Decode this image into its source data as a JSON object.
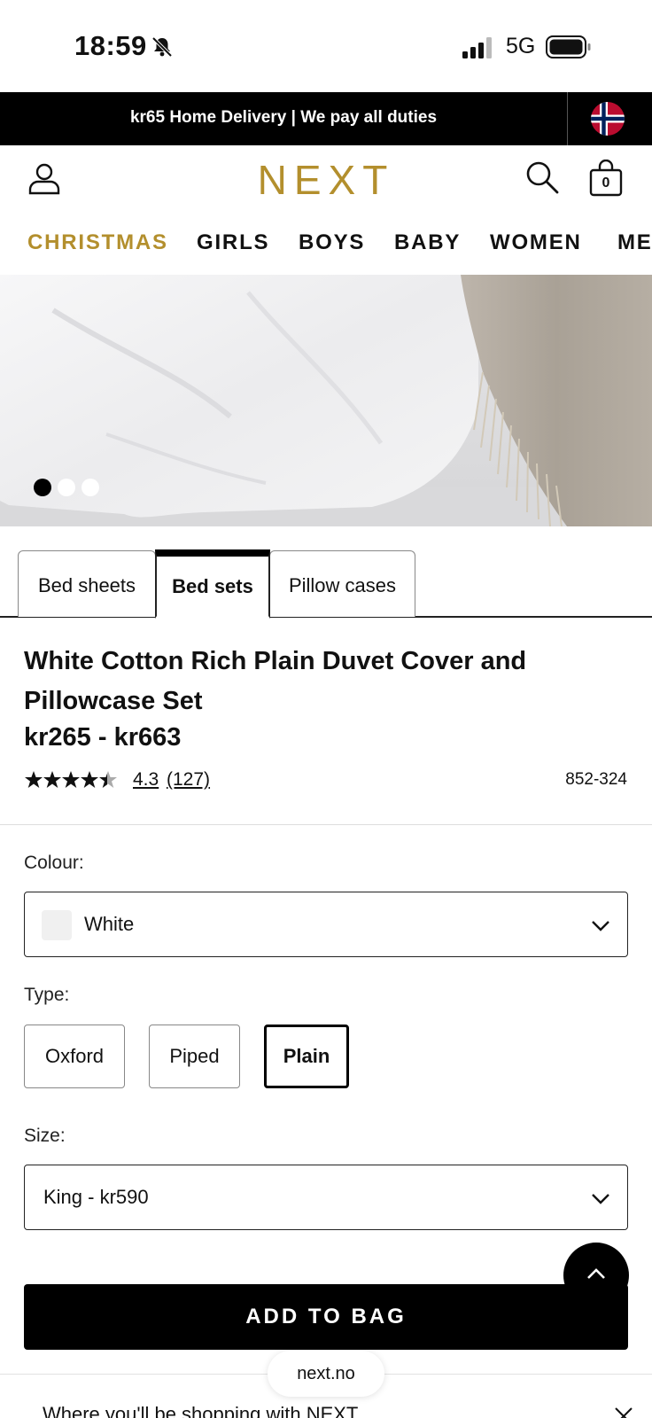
{
  "status_bar": {
    "time": "18:59",
    "network": "5G"
  },
  "promo": {
    "text": "kr65 Home Delivery | We pay all duties"
  },
  "header": {
    "logo": "NEXT",
    "bag_count": "0"
  },
  "categories": [
    "CHRISTMAS",
    "GIRLS",
    "BOYS",
    "BABY",
    "WOMEN",
    "ME"
  ],
  "hero": {
    "slide_count": 3,
    "active_slide": 1
  },
  "tabs": [
    {
      "label": "Bed sheets",
      "active": false
    },
    {
      "label": "Bed sets",
      "active": true
    },
    {
      "label": "Pillow cases",
      "active": false
    }
  ],
  "product": {
    "title": "White Cotton Rich Plain Duvet Cover and Pillowcase Set",
    "price": "kr265 - kr663",
    "rating": "4.3",
    "review_count": "(127)",
    "item_number": "852-324"
  },
  "colour": {
    "label": "Colour:",
    "value": "White",
    "swatch_color": "#f0f0f0"
  },
  "type": {
    "label": "Type:",
    "options": [
      "Oxford",
      "Piped",
      "Plain"
    ],
    "selected": "Plain"
  },
  "size": {
    "label": "Size:",
    "value": "King - kr590"
  },
  "add_to_bag": "ADD TO BAG",
  "url": "next.no",
  "banner": {
    "text": "Where you'll be shopping with NEXT"
  },
  "colors": {
    "brand_gold": "#b38f2d",
    "black": "#000000"
  }
}
